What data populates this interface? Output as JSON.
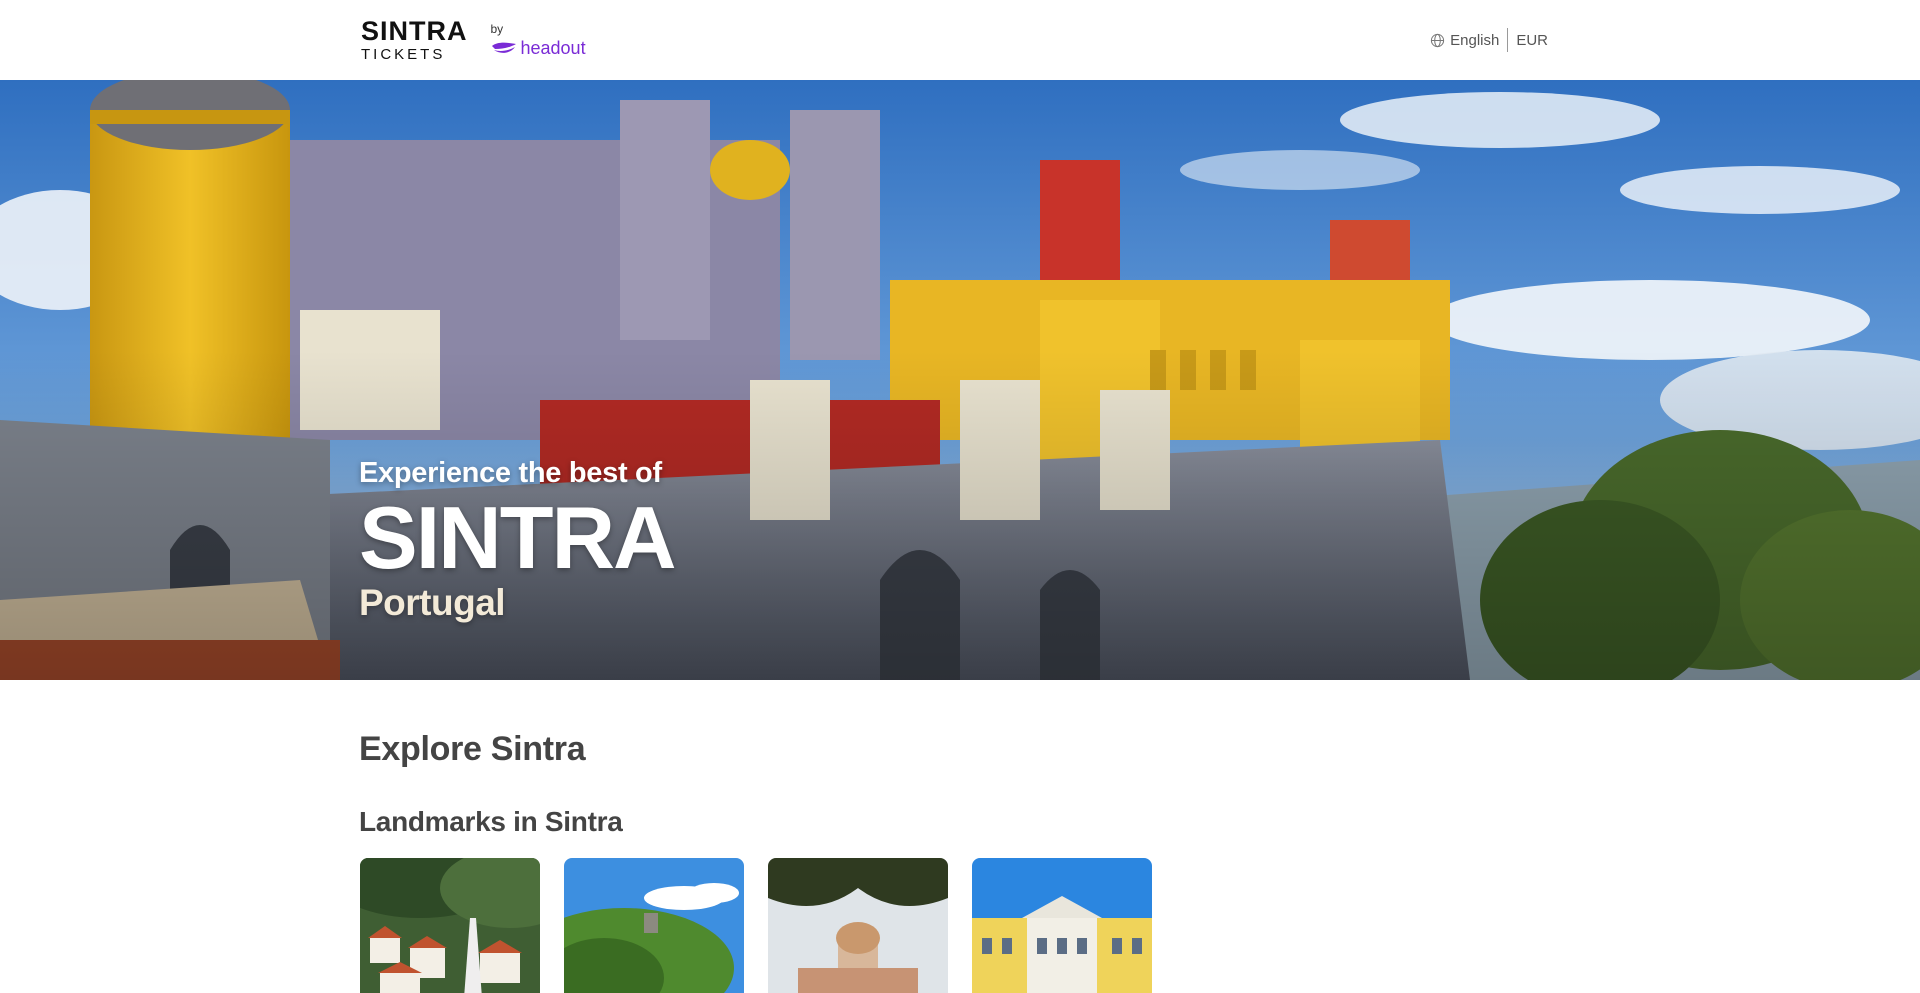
{
  "header": {
    "logo": {
      "title": "SINTRA",
      "subtitle": "TICKETS",
      "by": "by",
      "partner": "headout"
    },
    "locale": {
      "language": "English",
      "currency": "EUR",
      "language_icon": "globe-icon"
    }
  },
  "hero": {
    "tagline": "Experience the best of",
    "city": "SINTRA",
    "country": "Portugal"
  },
  "main": {
    "explore_title": "Explore Sintra",
    "landmarks_title": "Landmarks in Sintra",
    "landmark_cards": 4
  },
  "colors": {
    "brand_purple": "#7a2bd6",
    "heading_text": "#444444"
  }
}
